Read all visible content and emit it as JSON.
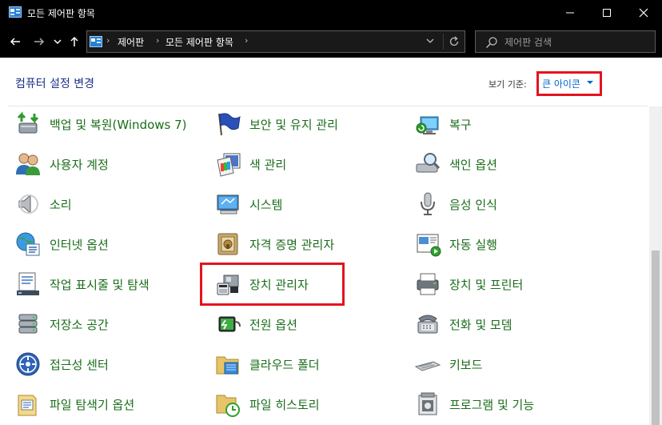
{
  "window": {
    "title": "모든 제어판 항목"
  },
  "nav": {
    "breadcrumbs": [
      "제어판",
      "모든 제어판 항목"
    ]
  },
  "search": {
    "placeholder": "제어판 검색"
  },
  "content": {
    "heading": "컴퓨터 설정 변경",
    "view_by_label": "보기 기준:",
    "view_by_value": "큰 아이콘"
  },
  "items": [
    {
      "label": "백업 및 복원(Windows 7)",
      "icon": "backup-restore-icon"
    },
    {
      "label": "보안 및 유지 관리",
      "icon": "security-maintenance-flag-icon"
    },
    {
      "label": "복구",
      "icon": "recovery-icon"
    },
    {
      "label": "사용자 계정",
      "icon": "user-accounts-icon"
    },
    {
      "label": "색 관리",
      "icon": "color-management-icon"
    },
    {
      "label": "색인 옵션",
      "icon": "indexing-options-icon"
    },
    {
      "label": "소리",
      "icon": "speaker-icon"
    },
    {
      "label": "시스템",
      "icon": "system-monitor-icon"
    },
    {
      "label": "음성 인식",
      "icon": "microphone-icon"
    },
    {
      "label": "인터넷 옵션",
      "icon": "internet-options-icon"
    },
    {
      "label": "자격 증명 관리자",
      "icon": "credential-manager-icon"
    },
    {
      "label": "자동 실행",
      "icon": "autoplay-icon"
    },
    {
      "label": "작업 표시줄 및 탐색",
      "icon": "taskbar-navigation-icon"
    },
    {
      "label": "장치 관리자",
      "icon": "device-manager-icon"
    },
    {
      "label": "장치 및 프린터",
      "icon": "devices-printers-icon"
    },
    {
      "label": "저장소 공간",
      "icon": "storage-spaces-icon"
    },
    {
      "label": "전원 옵션",
      "icon": "power-options-icon"
    },
    {
      "label": "전화 및 모뎀",
      "icon": "phone-modem-icon"
    },
    {
      "label": "접근성 센터",
      "icon": "ease-of-access-icon"
    },
    {
      "label": "클라우드 폴더",
      "icon": "work-folders-icon"
    },
    {
      "label": "키보드",
      "icon": "keyboard-icon"
    },
    {
      "label": "파일 탐색기 옵션",
      "icon": "file-explorer-options-icon"
    },
    {
      "label": "파일 히스토리",
      "icon": "file-history-icon"
    },
    {
      "label": "프로그램 및 기능",
      "icon": "programs-features-icon"
    }
  ],
  "colors": {
    "link_green": "#1a6c1a",
    "heading_blue": "#1e3287",
    "accent_blue": "#0066cc",
    "highlight_red": "#e3141f"
  }
}
